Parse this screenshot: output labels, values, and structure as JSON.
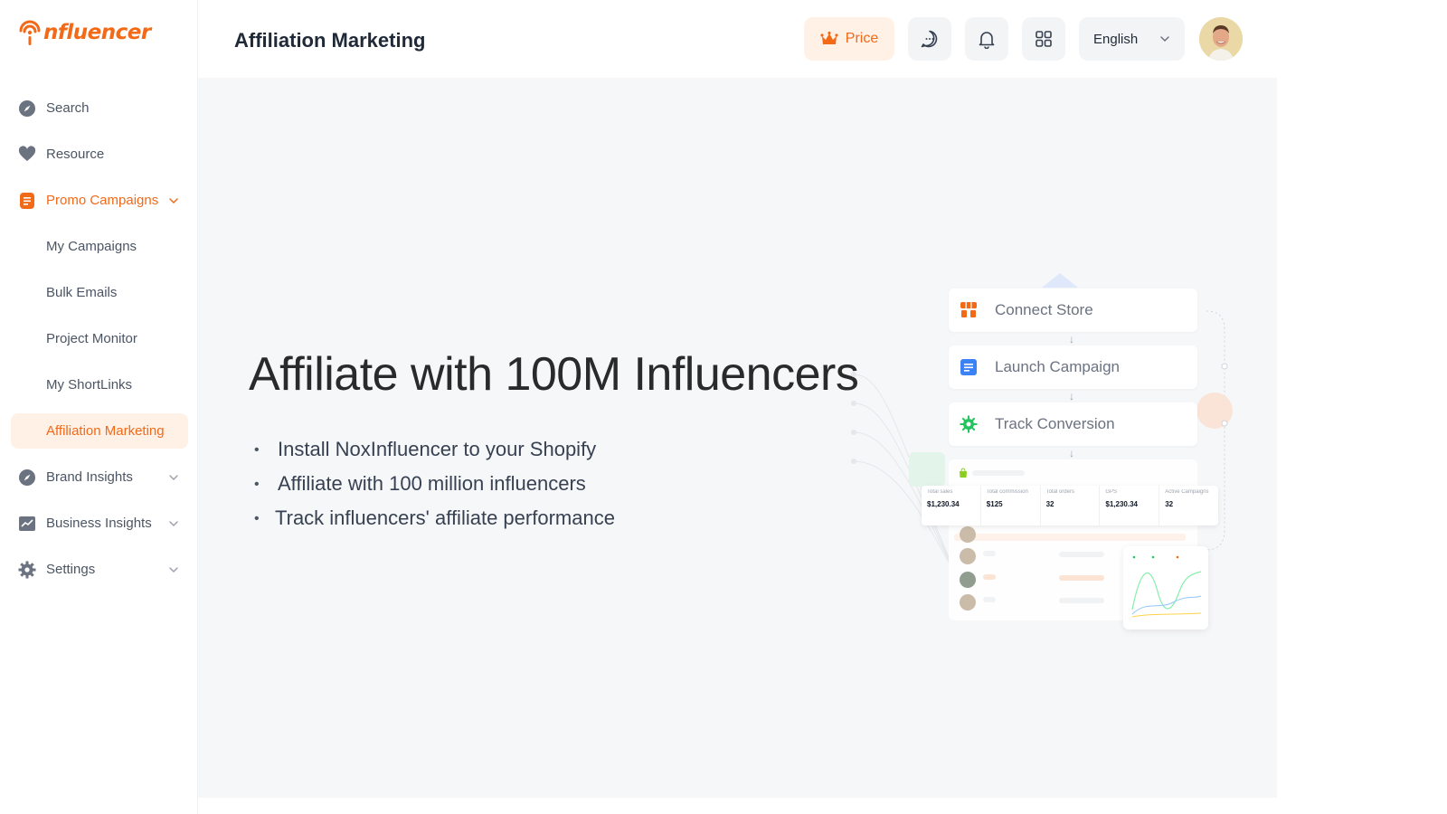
{
  "brand": {
    "logo_text": "nfluencer",
    "accent_color": "#f26a17"
  },
  "sidebar": {
    "items": [
      {
        "label": "Search",
        "icon": "compass-icon",
        "expandable": false,
        "state": "default"
      },
      {
        "label": "Resource",
        "icon": "heart-icon",
        "expandable": false,
        "state": "default"
      },
      {
        "label": "Promo Campaigns",
        "icon": "document-icon",
        "expandable": true,
        "state": "expanded"
      },
      {
        "label": "My Campaigns",
        "icon": "",
        "expandable": false,
        "state": "sub"
      },
      {
        "label": "Bulk Emails",
        "icon": "",
        "expandable": false,
        "state": "sub"
      },
      {
        "label": "Project Monitor",
        "icon": "",
        "expandable": false,
        "state": "sub"
      },
      {
        "label": "My ShortLinks",
        "icon": "",
        "expandable": false,
        "state": "sub"
      },
      {
        "label": "Affiliation Marketing",
        "icon": "",
        "expandable": false,
        "state": "active"
      },
      {
        "label": "Brand Insights",
        "icon": "compass-icon",
        "expandable": true,
        "state": "collapsed"
      },
      {
        "label": "Business Insights",
        "icon": "trend-chart-icon",
        "expandable": true,
        "state": "collapsed"
      },
      {
        "label": "Settings",
        "icon": "gear-icon",
        "expandable": true,
        "state": "collapsed"
      }
    ]
  },
  "header": {
    "title": "Affiliation Marketing",
    "price_label": "Price",
    "language": "English"
  },
  "hero": {
    "title": "Affiliate with 100M Influencers",
    "bullets": [
      "Install NoxInfluencer to your Shopify",
      "Affiliate with 100 million influencers",
      "Track influencers' affiliate performance"
    ]
  },
  "illustration": {
    "steps": [
      "Connect Store",
      "Launch Campaign",
      "Track Conversion"
    ],
    "stats": [
      {
        "label": "Total sales",
        "value": "$1,230.34"
      },
      {
        "label": "Total commission",
        "value": "$125"
      },
      {
        "label": "Total orders",
        "value": "32"
      },
      {
        "label": "GPS",
        "value": "$1,230.34"
      },
      {
        "label": "Active Campaigns",
        "value": "32"
      }
    ]
  }
}
